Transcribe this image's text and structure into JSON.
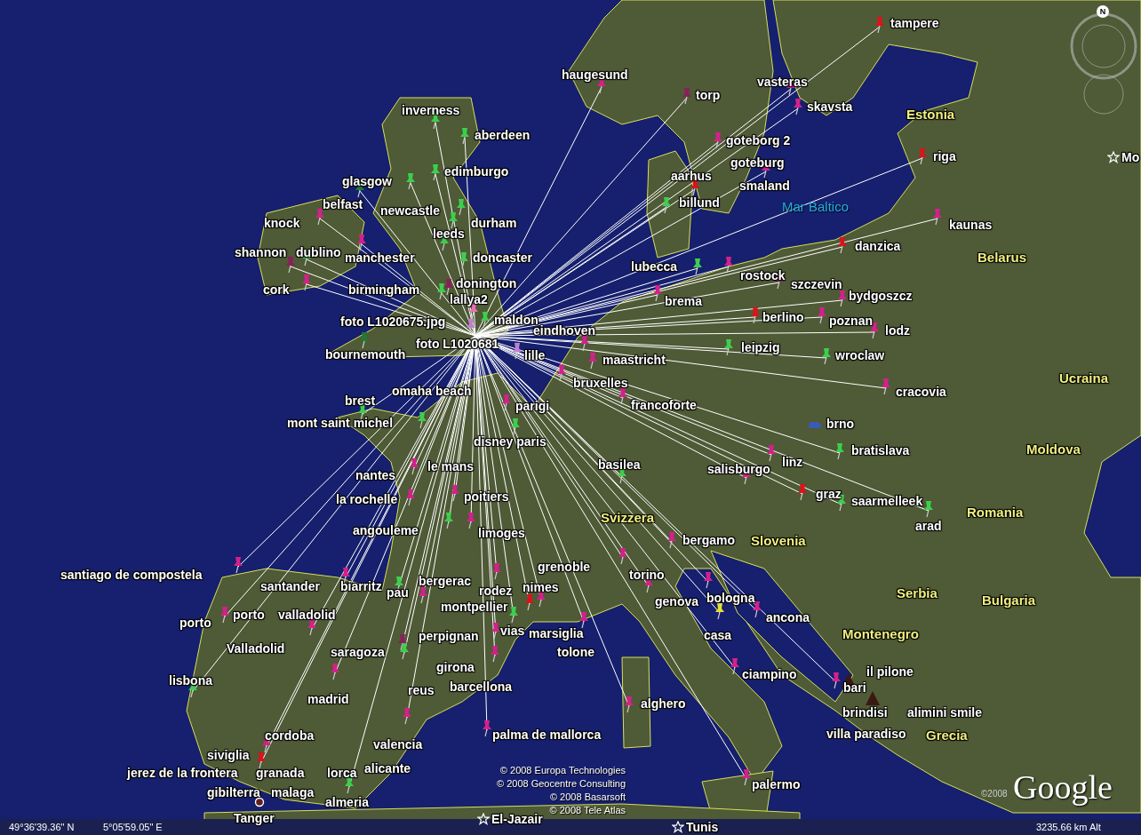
{
  "map": {
    "places": [
      {
        "label": "tampere",
        "kind": "pin",
        "color": "#e0101c"
      },
      {
        "label": "haugesund",
        "kind": "pin",
        "color": "#d4208c"
      },
      {
        "label": "torp",
        "kind": "pin",
        "color": "#8a1f5c"
      },
      {
        "label": "vasteras",
        "kind": "pin",
        "color": "#d4208c"
      },
      {
        "label": "inverness",
        "kind": "pin",
        "color": "#3ccf4e"
      },
      {
        "label": "skavsta",
        "kind": "pin",
        "color": "#d4208c"
      },
      {
        "label": "aberdeen",
        "kind": "pin",
        "color": "#3ccf4e"
      },
      {
        "label": "goteborg 2",
        "kind": "pin",
        "color": "#d4208c"
      },
      {
        "label": "glasgow",
        "kind": "pin",
        "color": "#3ccf4e"
      },
      {
        "label": "edimburgo",
        "kind": "pin",
        "color": "#3ccf4e"
      },
      {
        "label": "aarhus",
        "kind": "pin",
        "color": "#e0101c"
      },
      {
        "label": "goteburg",
        "kind": "pin",
        "color": "#d4208c"
      },
      {
        "label": "riga",
        "kind": "pin",
        "color": "#e0101c"
      },
      {
        "label": "belfast",
        "kind": "pin",
        "color": "#1f7a32"
      },
      {
        "label": "knock",
        "kind": "pin",
        "color": "#d4208c"
      },
      {
        "label": "newcastle",
        "kind": "pin",
        "color": "#3ccf4e"
      },
      {
        "label": "billund",
        "kind": "pin",
        "color": "#3ccf4e"
      },
      {
        "label": "leeds",
        "kind": "pin",
        "color": "#3ccf4e"
      },
      {
        "label": "durham",
        "kind": "pin",
        "color": "#3ccf4e"
      },
      {
        "label": "kaunas",
        "kind": "pin",
        "color": "#d4208c"
      },
      {
        "label": "shannon",
        "kind": "pin",
        "color": "#8a1f5c"
      },
      {
        "label": "dublino",
        "kind": "pin",
        "color": "#3ccf4e"
      },
      {
        "label": "manchester",
        "kind": "pin",
        "color": "#d4208c"
      },
      {
        "label": "doncaster",
        "kind": "pin",
        "color": "#3ccf4e"
      },
      {
        "label": "danzica",
        "kind": "pin",
        "color": "#e0101c"
      },
      {
        "label": "lubecca",
        "kind": "pin",
        "color": "#3ccf4e"
      },
      {
        "label": "cork",
        "kind": "pin",
        "color": "#d4208c"
      },
      {
        "label": "birmingham",
        "kind": "pin",
        "color": "#3ccf4e"
      },
      {
        "label": "donington",
        "kind": "pin",
        "color": "#8a1f5c"
      },
      {
        "label": "rostock",
        "kind": "pin",
        "color": "#d4208c"
      },
      {
        "label": "szczevin",
        "kind": "pin",
        "color": "#8a1f5c"
      },
      {
        "label": "lallya2",
        "kind": "pin",
        "color": "#e870b0"
      },
      {
        "label": "brema",
        "kind": "pin",
        "color": "#d4208c"
      },
      {
        "label": "bydgoszcz",
        "kind": "pin",
        "color": "#d4208c"
      },
      {
        "label": "foto L1020675.jpg",
        "kind": "pin",
        "color": "#c080d0"
      },
      {
        "label": "maldon",
        "kind": "pin",
        "color": "#3ccf4e"
      },
      {
        "label": "eindhoven",
        "kind": "pin",
        "color": "#d4208c"
      },
      {
        "label": "berlino",
        "kind": "pin",
        "color": "#e0101c"
      },
      {
        "label": "poznan",
        "kind": "pin",
        "color": "#d4208c"
      },
      {
        "label": "lodz",
        "kind": "pin",
        "color": "#d4208c"
      },
      {
        "label": "bournemouth",
        "kind": "pin",
        "color": "#1f7a32"
      },
      {
        "label": "lille",
        "kind": "pin",
        "color": "#c080d0"
      },
      {
        "label": "maastricht",
        "kind": "pin",
        "color": "#d4208c"
      },
      {
        "label": "leipzig",
        "kind": "pin",
        "color": "#3ccf4e"
      },
      {
        "label": "wroclaw",
        "kind": "pin",
        "color": "#3ccf4e"
      },
      {
        "label": "bruxelles",
        "kind": "pin",
        "color": "#d4208c"
      },
      {
        "label": "cracovia",
        "kind": "pin",
        "color": "#d4208c"
      },
      {
        "label": "brest",
        "kind": "pin",
        "color": "#3ccf4e"
      },
      {
        "label": "parigi",
        "kind": "pin",
        "color": "#d4208c"
      },
      {
        "label": "francoforte",
        "kind": "pin",
        "color": "#d4208c"
      },
      {
        "label": "mont saint michel",
        "kind": "pin",
        "color": "#3ccf4e"
      },
      {
        "label": "brno",
        "kind": "car"
      },
      {
        "label": "disney paris",
        "kind": "pin",
        "color": "#3ccf4e"
      },
      {
        "label": "bratislava",
        "kind": "pin",
        "color": "#3ccf4e"
      },
      {
        "label": "le mans",
        "kind": "pin",
        "color": "#d4208c"
      },
      {
        "label": "basilea",
        "kind": "pin",
        "color": "#3ccf4e"
      },
      {
        "label": "salisburgo",
        "kind": "pin",
        "color": "#d4208c"
      },
      {
        "label": "linz",
        "kind": "pin",
        "color": "#d4208c"
      },
      {
        "label": "la rochelle",
        "kind": "pin",
        "color": "#d4208c"
      },
      {
        "label": "poitiers",
        "kind": "pin",
        "color": "#d4208c"
      },
      {
        "label": "graz",
        "kind": "pin",
        "color": "#e0101c"
      },
      {
        "label": "saarmelleek",
        "kind": "pin",
        "color": "#3ccf4e"
      },
      {
        "label": "angouleme",
        "kind": "pin",
        "color": "#3ccf4e"
      },
      {
        "label": "limoges",
        "kind": "pin",
        "color": "#d4208c"
      },
      {
        "label": "bergamo",
        "kind": "pin",
        "color": "#d4208c"
      },
      {
        "label": "arad",
        "kind": "pin",
        "color": "#3ccf4e"
      },
      {
        "label": "santiago de compostela",
        "kind": "pin",
        "color": "#d4208c"
      },
      {
        "label": "grenoble",
        "kind": "pin",
        "color": "#d4208c"
      },
      {
        "label": "biarritz",
        "kind": "pin",
        "color": "#d4208c"
      },
      {
        "label": "pau",
        "kind": "pin",
        "color": "#3ccf4e"
      },
      {
        "label": "bergerac",
        "kind": "pin",
        "color": "#d4208c"
      },
      {
        "label": "nimes",
        "kind": "pin",
        "color": "#d4208c"
      },
      {
        "label": "torino",
        "kind": "pin",
        "color": "#d4208c"
      },
      {
        "label": "porto",
        "kind": "pin",
        "color": "#d4208c"
      },
      {
        "label": "valladolid",
        "kind": "pin",
        "color": "#d4208c"
      },
      {
        "label": "montpellier",
        "kind": "pin",
        "color": "#e0101c"
      },
      {
        "label": "genova",
        "kind": "pin",
        "color": "#d4208c"
      },
      {
        "label": "bologna",
        "kind": "pin",
        "color": "#d4208c"
      },
      {
        "label": "perpignan",
        "kind": "pin",
        "color": "#8a1f5c"
      },
      {
        "label": "vias",
        "kind": "pin",
        "color": "#d4208c"
      },
      {
        "label": "ancona",
        "kind": "pin",
        "color": "#d4208c"
      },
      {
        "label": "marsiglia",
        "kind": "pin",
        "color": "#3ccf4e"
      },
      {
        "label": "casa",
        "kind": "pin",
        "color": "#e8e030"
      },
      {
        "label": "saragoza",
        "kind": "pin",
        "color": "#3ccf4e"
      },
      {
        "label": "tolone",
        "kind": "pin",
        "color": "#d4208c"
      },
      {
        "label": "lisbona",
        "kind": "pin",
        "color": "#3ccf4e"
      },
      {
        "label": "girona",
        "kind": "pin",
        "color": "#d4208c"
      },
      {
        "label": "ciampino",
        "kind": "pin",
        "color": "#d4208c"
      },
      {
        "label": "il pilone",
        "kind": "peak"
      },
      {
        "label": "madrid",
        "kind": "pin",
        "color": "#d4208c"
      },
      {
        "label": "bari",
        "kind": "pin",
        "color": "#d4208c"
      },
      {
        "label": "alghero",
        "kind": "pin",
        "color": "#d4208c"
      },
      {
        "label": "brindisi",
        "kind": "peak"
      },
      {
        "label": "cordoba",
        "kind": "pin",
        "color": "#d4208c"
      },
      {
        "label": "valencia",
        "kind": "pin",
        "color": "#d4208c"
      },
      {
        "label": "palma de mallorca",
        "kind": "pin",
        "color": "#d4208c"
      },
      {
        "label": "siviglia",
        "kind": "pin",
        "color": "#e0101c"
      },
      {
        "label": "palermo",
        "kind": "pin",
        "color": "#d4208c"
      },
      {
        "label": "almeria",
        "kind": "pin",
        "color": "#3ccf4e"
      }
    ],
    "labels": [
      "smaland",
      "foto L1020681",
      "omaha beach",
      "nantes",
      "santander",
      "rodez",
      "porto",
      "Valladolid",
      "reus",
      "barcellona",
      "alimini smile",
      "villa paradiso",
      "jerez de la frontera",
      "granada",
      "lorca",
      "alicante",
      "gibilterra",
      "malaga"
    ],
    "countries": [
      "Estonia",
      "Belarus",
      "Ucraina",
      "Moldova",
      "Svizzera",
      "Romania",
      "Slovenia",
      "Serbia",
      "Bulgaria",
      "Montenegro",
      "Grecia"
    ],
    "seas": [
      "Mar Baltico"
    ],
    "capitals": [
      {
        "label": "Mo",
        "kind": "star"
      },
      {
        "label": "Tanger",
        "kind": "circle"
      },
      {
        "label": "El-Jazair",
        "kind": "star"
      },
      {
        "label": "Tunis",
        "kind": "star"
      }
    ],
    "compass": {
      "north": "N"
    }
  },
  "copyright": [
    "© 2008 Europa Technologies",
    "© 2008 Geocentre Consulting",
    "© 2008 Basarsoft",
    "© 2008 Tele Atlas"
  ],
  "logo": {
    "year": "©2008",
    "name": "Google"
  },
  "status_bar": {
    "latitude": "49°36'39.36\" N",
    "longitude": "5°05'59.05\" E",
    "altitude": "3235.66 km Alt"
  }
}
